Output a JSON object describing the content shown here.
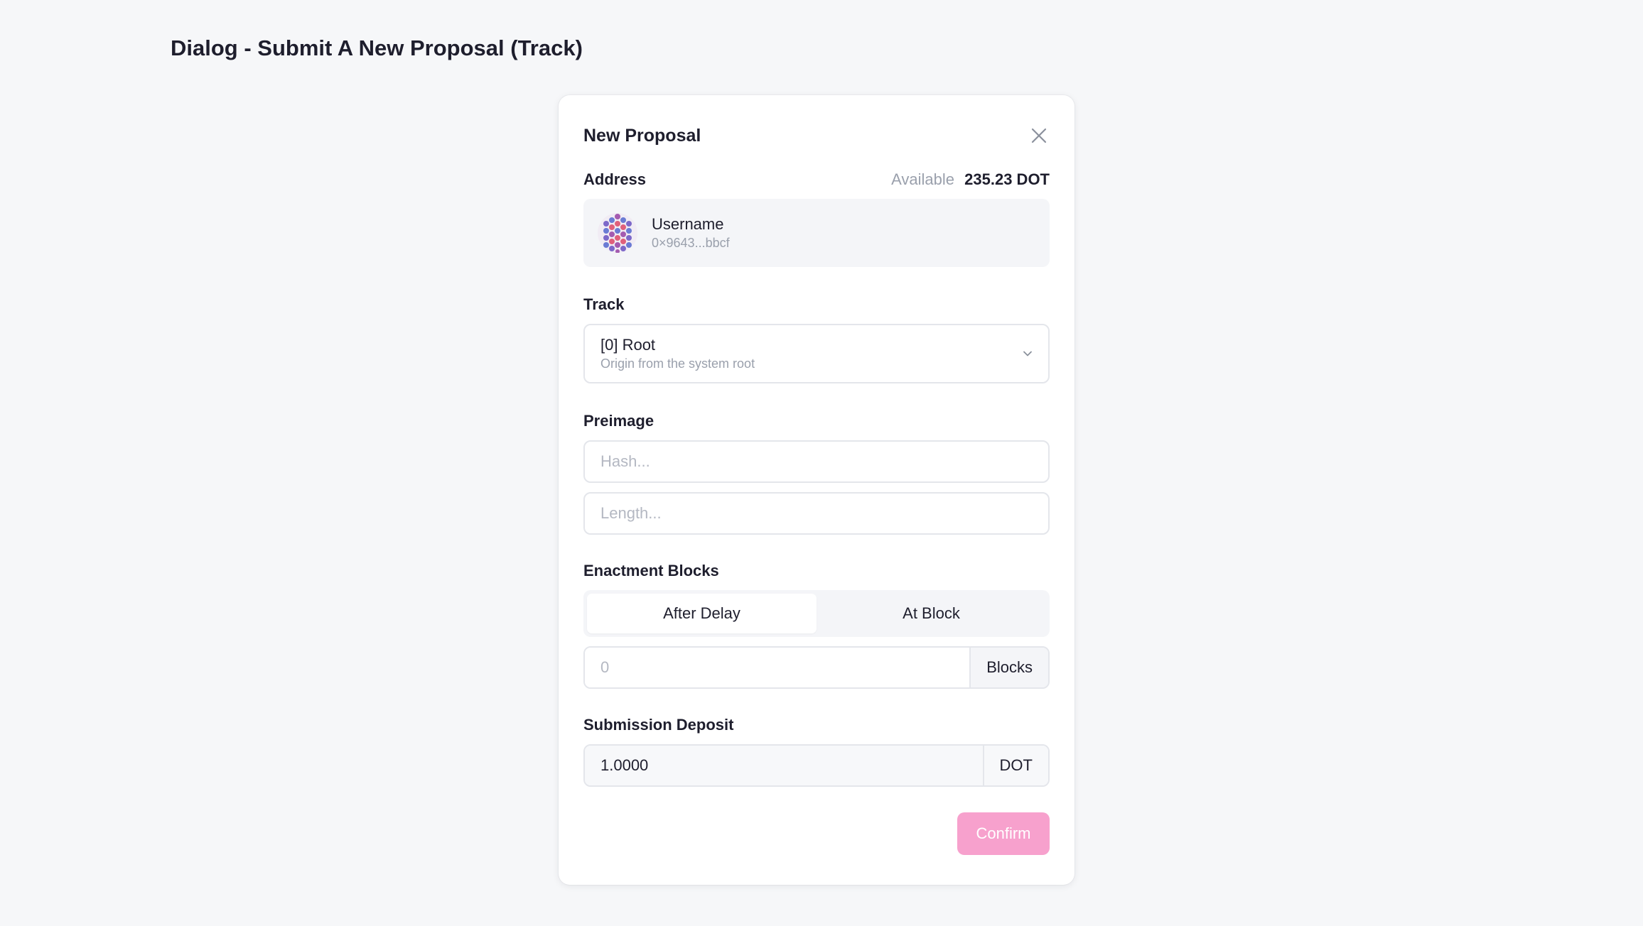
{
  "page": {
    "title": "Dialog - Submit A New Proposal (Track)"
  },
  "dialog": {
    "title": "New Proposal",
    "close_icon": "close-icon",
    "address": {
      "label": "Address",
      "available_label": "Available",
      "available_value": "235.23 DOT",
      "account_name": "Username",
      "account_address": "0×9643...bbcf"
    },
    "track": {
      "label": "Track",
      "selected_title": "[0] Root",
      "selected_description": "Origin from the system root",
      "chevron_icon": "chevron-down-icon"
    },
    "preimage": {
      "label": "Preimage",
      "hash_placeholder": "Hash...",
      "length_placeholder": "Length..."
    },
    "enactment": {
      "label": "Enactment Blocks",
      "options": [
        "After Delay",
        "At Block"
      ],
      "selected": "After Delay",
      "blocks_placeholder": "0",
      "blocks_unit": "Blocks"
    },
    "deposit": {
      "label": "Submission Deposit",
      "value": "1.0000",
      "unit": "DOT"
    },
    "confirm_label": "Confirm"
  },
  "colors": {
    "background": "#f6f7f9",
    "accent_disabled": "#f7a1cd",
    "text_primary": "#1e1e2d",
    "text_muted": "#9aa0ac"
  }
}
